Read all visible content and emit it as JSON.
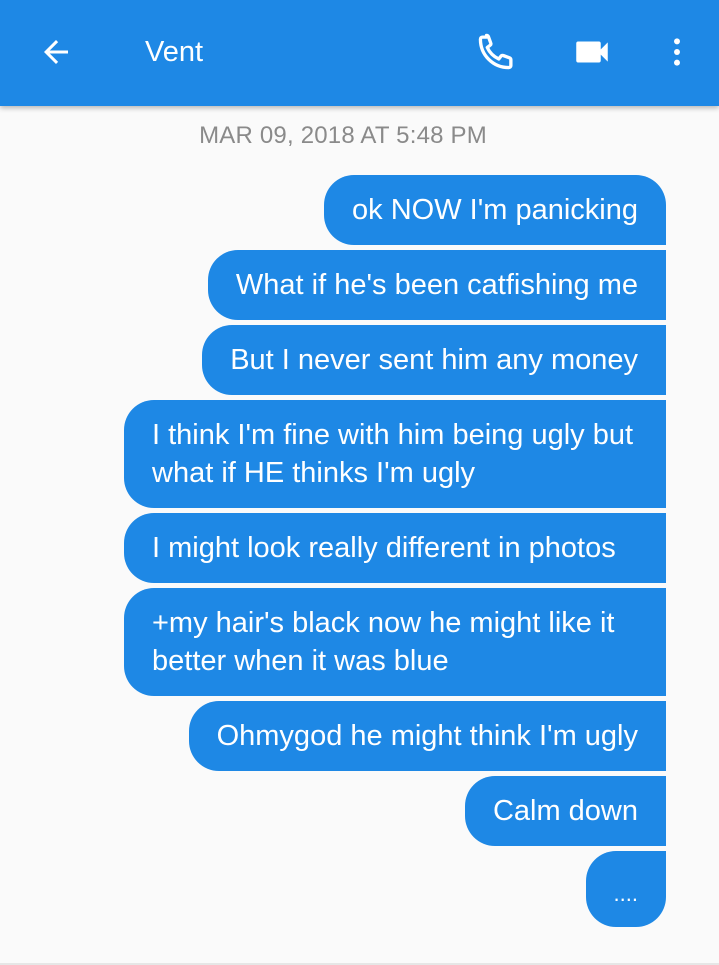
{
  "header": {
    "title": "Vent",
    "back_icon": "arrow-back-icon",
    "call_icon": "phone-icon",
    "video_icon": "videocam-icon",
    "more_icon": "more-vert-icon",
    "bar_color": "#1e88e5"
  },
  "conversation": {
    "timestamp": "MAR 09, 2018 AT 5:48 PM",
    "bubble_color": "#1e88e5",
    "messages": [
      {
        "text": "ok NOW I'm panicking"
      },
      {
        "text": "What if he's been catfishing me"
      },
      {
        "text": "But I never sent him any money"
      },
      {
        "text": "I think I'm fine with him being ugly but what if HE thinks I'm ugly"
      },
      {
        "text": "I might look really different in photos"
      },
      {
        "text": "+my hair's black now he might like it better when it was blue"
      },
      {
        "text": "Ohmygod he might think I'm ugly"
      },
      {
        "text": "Calm down"
      },
      {
        "text": "...."
      }
    ]
  }
}
